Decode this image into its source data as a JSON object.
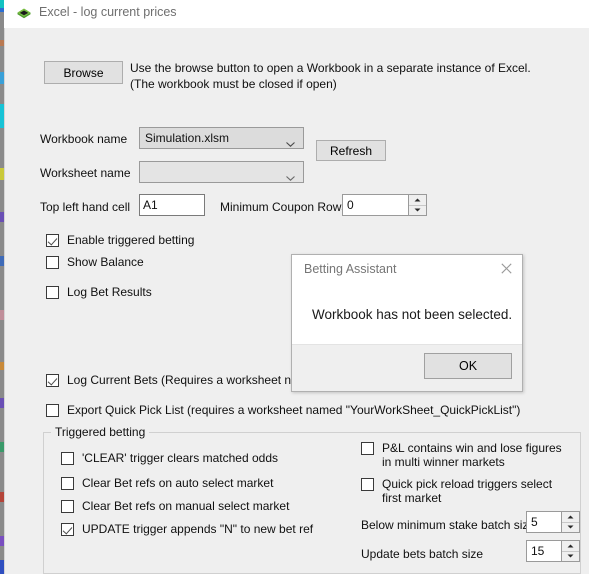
{
  "window": {
    "title": "Excel - log current prices",
    "icon": "excel-diamond-icon"
  },
  "toolbar": {
    "browse_label": "Browse",
    "description_line1": "Use the browse button to open a Workbook in a separate instance of Excel.",
    "description_line2": "(The workbook must be closed if open)"
  },
  "form": {
    "workbook_label": "Workbook name",
    "workbook_value": "Simulation.xlsm",
    "refresh_label": "Refresh",
    "worksheet_label": "Worksheet name",
    "worksheet_value": "",
    "topleft_label": "Top left hand cell",
    "topleft_value": "A1",
    "mincoupon_label": "Minimum Coupon Rows",
    "mincoupon_value": "0"
  },
  "options": {
    "enable_triggered_betting": "Enable triggered betting",
    "show_balance": "Show Balance",
    "log_bet_results": "Log Bet Results",
    "log_current_bets": "Log Current Bets (Requires a worksheet named 'YourWorkSheet_LogCurrentBets')",
    "export_quick_pick": "Export Quick Pick List (requires a worksheet named \"YourWorkSheet_QuickPickList\")"
  },
  "triggered_betting": {
    "group_label": "Triggered betting",
    "clear_trigger": "'CLEAR' trigger clears matched odds",
    "clear_auto": "Clear Bet refs on auto select market",
    "clear_manual": "Clear Bet refs on manual select market",
    "update_trigger": "UPDATE trigger appends \"N\" to new bet ref",
    "pl_contains": "P&L contains win and lose figures in multi winner markets",
    "quick_pick_reload": "Quick pick reload triggers select first market",
    "below_min_label": "Below minimum stake batch size",
    "below_min_value": "5",
    "update_bets_label": "Update bets batch size",
    "update_bets_value": "15"
  },
  "dialog": {
    "title": "Betting Assistant",
    "message": "Workbook has not been selected.",
    "ok_label": "OK",
    "close_icon": "close-icon"
  }
}
